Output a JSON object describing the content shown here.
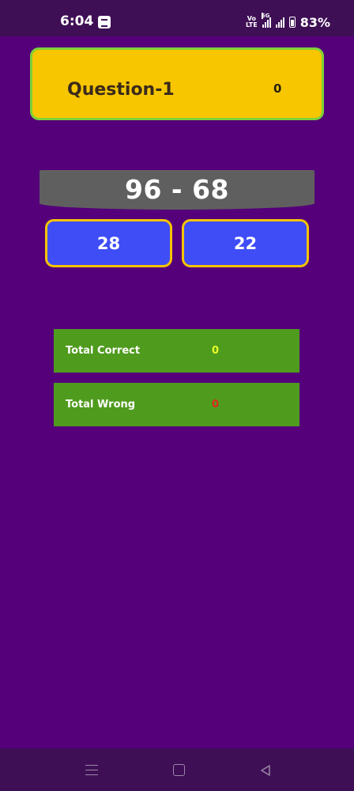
{
  "status_bar": {
    "time": "6:04",
    "volte_label_top": "Vo",
    "volte_label_bottom": "LTE",
    "network_label": "5G",
    "battery_percent": "83%"
  },
  "question": {
    "title": "Question-1",
    "score": "0"
  },
  "equation": "96 - 68",
  "answers": [
    "28",
    "22"
  ],
  "stats": {
    "correct_label": "Total Correct",
    "correct_value": "0",
    "wrong_label": "Total Wrong",
    "wrong_value": "0"
  },
  "colors": {
    "background": "#55007a",
    "question_card": "#f7c600",
    "answer_button": "#3f4df7",
    "stat_row": "#4f9b1e"
  }
}
